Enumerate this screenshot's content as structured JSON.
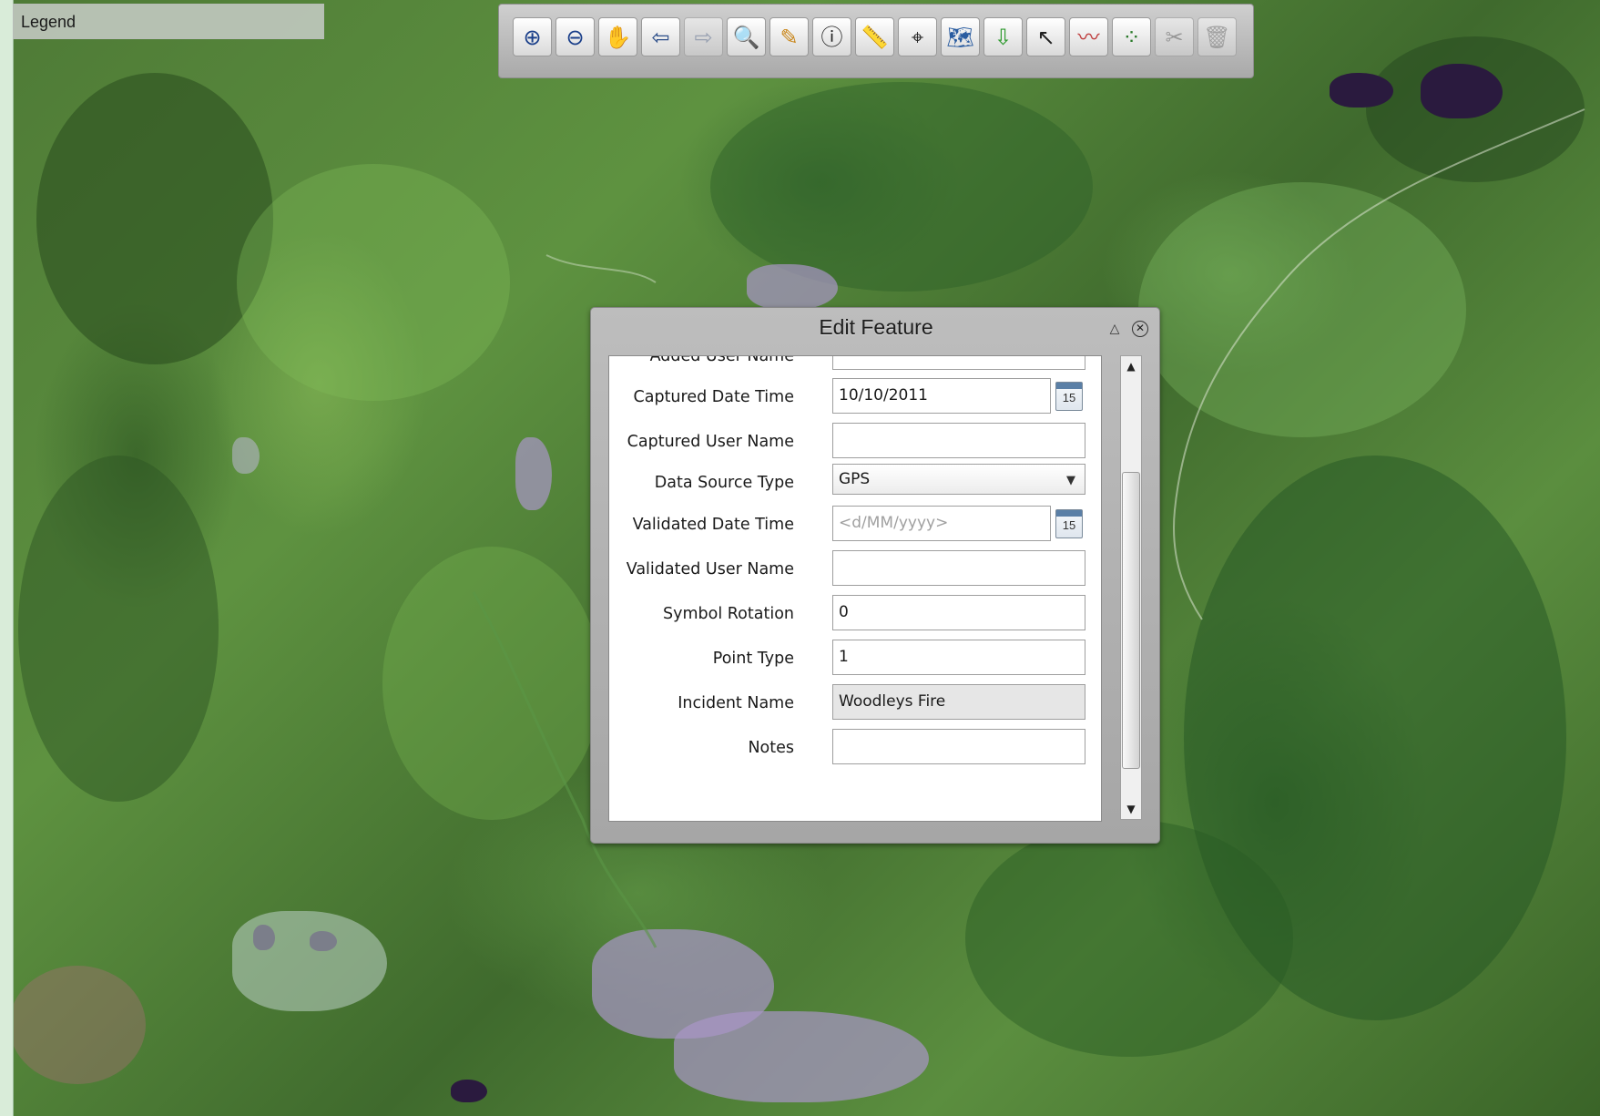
{
  "legend": {
    "title": "Legend"
  },
  "toolbar": {
    "buttons": [
      {
        "name": "zoom-in-icon",
        "glyph": "⊕",
        "color": "#1a3f8a",
        "enabled": true
      },
      {
        "name": "zoom-out-icon",
        "glyph": "⊖",
        "color": "#1a3f8a",
        "enabled": true
      },
      {
        "name": "pan-hand-icon",
        "glyph": "✋",
        "color": "#b07a3a",
        "enabled": true
      },
      {
        "name": "back-arrow-icon",
        "glyph": "⇦",
        "color": "#2d4f8a",
        "enabled": true
      },
      {
        "name": "forward-arrow-icon",
        "glyph": "⇨",
        "color": "#7a8aa8",
        "enabled": false
      },
      {
        "name": "identify-globe-icon",
        "glyph": "🔍",
        "color": "#2a5ca0",
        "enabled": true
      },
      {
        "name": "edit-notepad-icon",
        "glyph": "✎",
        "color": "#c9861a",
        "enabled": true
      },
      {
        "name": "info-icon",
        "glyph": "ⓘ",
        "color": "#222222",
        "enabled": true
      },
      {
        "name": "measure-ruler-icon",
        "glyph": "📏",
        "color": "#333333",
        "enabled": true
      },
      {
        "name": "locate-crosshair-icon",
        "glyph": "⌖",
        "color": "#222222",
        "enabled": true
      },
      {
        "name": "map-layers-icon",
        "glyph": "🗺",
        "color": "#2a5ca0",
        "enabled": true
      },
      {
        "name": "download-icon",
        "glyph": "⇩",
        "color": "#2e9a2e",
        "enabled": true
      },
      {
        "name": "select-pointer-icon",
        "glyph": "↖",
        "color": "#222222",
        "enabled": true
      },
      {
        "name": "draw-line-icon",
        "glyph": "〰",
        "color": "#c04040",
        "enabled": true
      },
      {
        "name": "draw-points-icon",
        "glyph": "⁘",
        "color": "#2a7a2a",
        "enabled": true
      },
      {
        "name": "cut-scissors-icon",
        "glyph": "✂",
        "color": "#777777",
        "enabled": false
      },
      {
        "name": "delete-bin-icon",
        "glyph": "🗑",
        "color": "#888888",
        "enabled": false
      }
    ]
  },
  "dialog": {
    "title": "Edit Feature",
    "fields": {
      "added_user_name": {
        "label": "Added User Name",
        "value": ""
      },
      "captured_date_time": {
        "label": "Captured Date Time",
        "value": "10/10/2011",
        "calendar_day": "15"
      },
      "captured_user_name": {
        "label": "Captured User Name",
        "value": ""
      },
      "data_source_type": {
        "label": "Data Source Type",
        "value": "GPS"
      },
      "validated_date_time": {
        "label": "Validated Date Time",
        "value": "",
        "placeholder": "<d/MM/yyyy>",
        "calendar_day": "15"
      },
      "validated_user_name": {
        "label": "Validated User Name",
        "value": ""
      },
      "symbol_rotation": {
        "label": "Symbol Rotation",
        "value": "0"
      },
      "point_type": {
        "label": "Point Type",
        "value": "1"
      },
      "incident_name": {
        "label": "Incident Name",
        "value": "Woodleys Fire"
      },
      "notes": {
        "label": "Notes",
        "value": ""
      }
    }
  }
}
